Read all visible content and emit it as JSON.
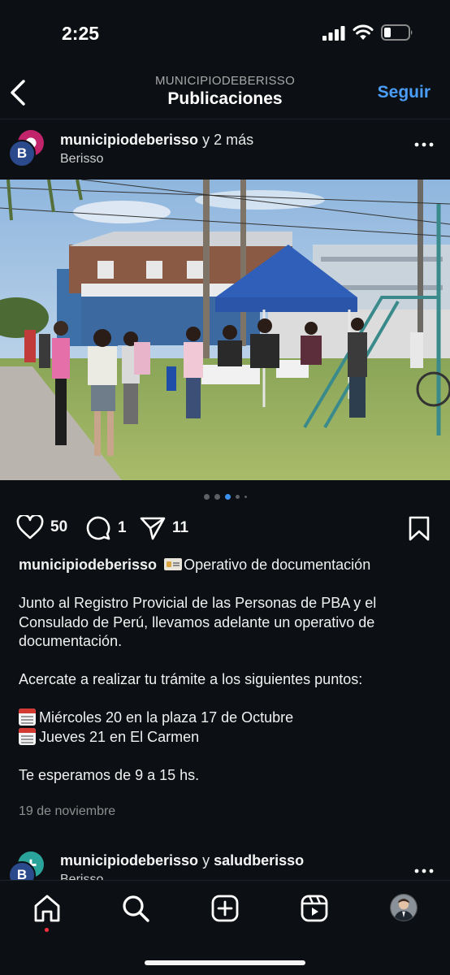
{
  "status_bar": {
    "time": "2:25"
  },
  "header": {
    "account_name": "MUNICIPIODEBERISSO",
    "title": "Publicaciones",
    "follow_label": "Seguir"
  },
  "post": {
    "username": "municipiodeberisso",
    "collaborators": "y 2 más",
    "location": "Berisso",
    "avatar_letter": "B",
    "carousel": {
      "count": 5,
      "active_index": 2
    },
    "likes": "50",
    "comments": "1",
    "shares": "11",
    "caption": {
      "username": "municipiodeberisso",
      "headline": "Operativo de documentación",
      "paragraph1": "Junto al Registro Provicial de las Personas de PBA y el Consulado de Perú, llevamos adelante un operativo de documentación.",
      "paragraph2": "Acercate a realizar tu trámite a los siguientes puntos:",
      "item1": "Miércoles 20 en la plaza 17 de Octubre",
      "item2": "Jueves 21 en El Carmen",
      "closing": "Te esperamos de 9 a 15 hs."
    },
    "date": "19 de noviembre"
  },
  "next_post": {
    "username": "municipiodeberisso",
    "connector": "y",
    "collaborator": "saludberisso",
    "location": "Berisso",
    "avatar_letter": "B"
  },
  "icons": {
    "status": [
      "signal-icon",
      "wifi-icon",
      "battery-icon"
    ],
    "post_actions": [
      "heart-icon",
      "comment-icon",
      "send-icon",
      "bookmark-icon"
    ],
    "tabs": [
      "home-icon",
      "search-icon",
      "create-icon",
      "reels-icon",
      "profile-avatar"
    ]
  },
  "colors": {
    "background": "#0c1014",
    "accent": "#4a9df8",
    "active_dot": "#3b91f0",
    "notification": "#ff3040"
  }
}
